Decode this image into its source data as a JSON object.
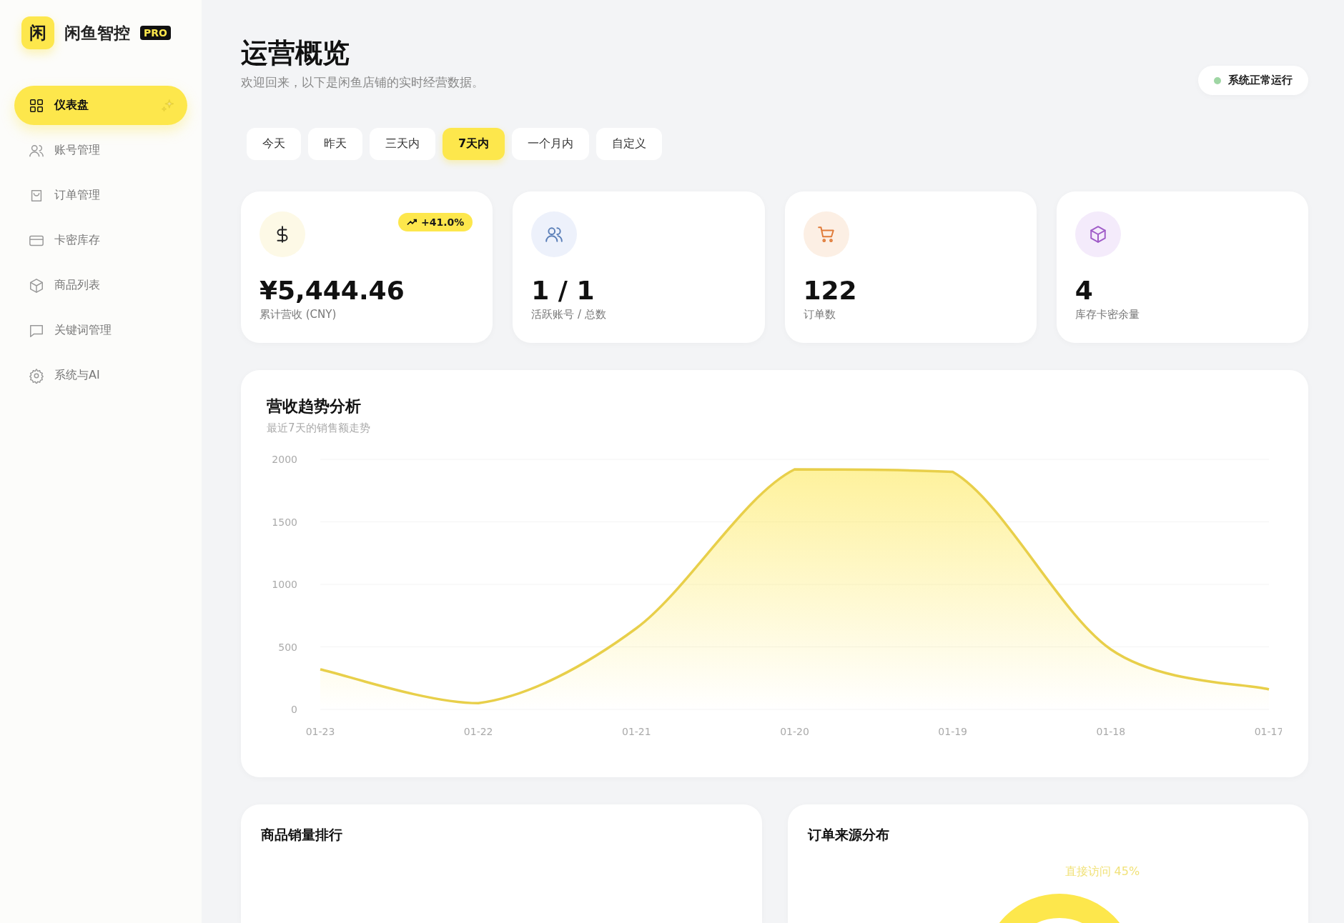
{
  "brand": {
    "logo_char": "闲",
    "name": "闲鱼智控",
    "badge": "PRO"
  },
  "sidebar": {
    "items": [
      {
        "label": "仪表盘",
        "selected": true
      },
      {
        "label": "账号管理",
        "selected": false
      },
      {
        "label": "订单管理",
        "selected": false
      },
      {
        "label": "卡密库存",
        "selected": false
      },
      {
        "label": "商品列表",
        "selected": false
      },
      {
        "label": "关键词管理",
        "selected": false
      },
      {
        "label": "系统与AI",
        "selected": false
      }
    ]
  },
  "header": {
    "title": "运营概览",
    "subtitle": "欢迎回来，以下是闲鱼店铺的实时经营数据。",
    "status": {
      "label": "系统正常运行",
      "ok": true
    }
  },
  "tabs": [
    {
      "label": "今天",
      "selected": false
    },
    {
      "label": "昨天",
      "selected": false
    },
    {
      "label": "三天内",
      "selected": false
    },
    {
      "label": "7天内",
      "selected": true
    },
    {
      "label": "一个月内",
      "selected": false
    },
    {
      "label": "自定义",
      "selected": false
    }
  ],
  "stats": [
    {
      "value": "¥5,444.46",
      "label": "累计营收 (CNY)",
      "color": "#222222",
      "badge": "+41.0%"
    },
    {
      "value": "1 / 1",
      "label": "活跃账号 / 总数",
      "color": "#5b7fb8"
    },
    {
      "value": "122",
      "label": "订单数",
      "color": "#e07b39"
    },
    {
      "value": "4",
      "label": "库存卡密余量",
      "color": "#a05cc8"
    }
  ],
  "revenue_chart": {
    "title": "营收趋势分析",
    "subtitle": "最近7天的销售额走势",
    "chart_data": {
      "type": "area",
      "categories": [
        "01-23",
        "01-22",
        "01-21",
        "01-20",
        "01-19",
        "01-18",
        "01-17"
      ],
      "grid": true,
      "series": [
        {
          "color": "#e8cf4a",
          "values": [
            320,
            50,
            650,
            1920,
            1900,
            480,
            160
          ]
        }
      ],
      "ylim": [
        0,
        2000
      ],
      "yticks": [
        0,
        500,
        1000,
        1500,
        2000
      ]
    }
  },
  "panels": [
    {
      "title": "商品销量排行"
    },
    {
      "title": "订单来源分布",
      "donut_label": "直接访问 45%"
    }
  ]
}
